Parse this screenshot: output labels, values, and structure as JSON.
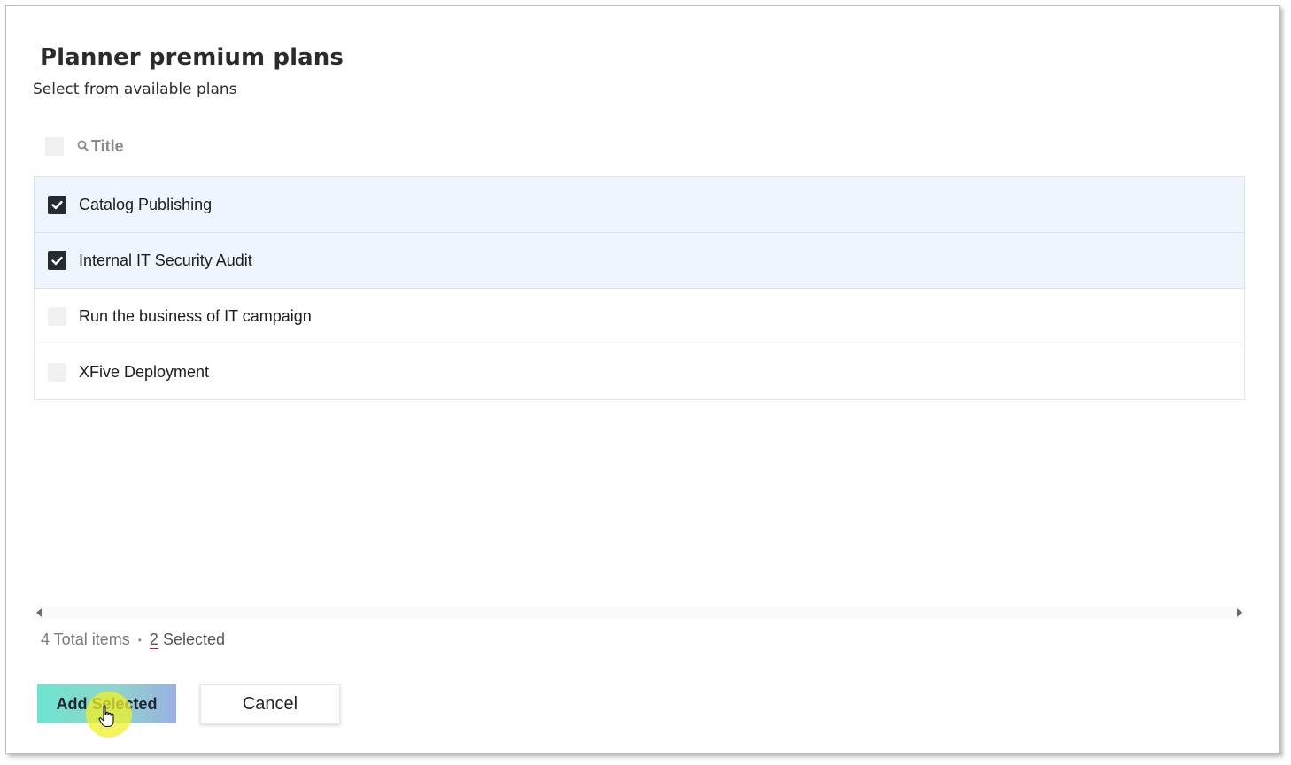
{
  "dialog": {
    "title": "Planner premium plans",
    "subtitle": "Select from available plans"
  },
  "table": {
    "header_label": "Title",
    "rows": [
      {
        "label": "Catalog Publishing",
        "checked": true
      },
      {
        "label": "Internal IT Security Audit",
        "checked": true
      },
      {
        "label": "Run the business of IT campaign",
        "checked": false
      },
      {
        "label": "XFive Deployment",
        "checked": false
      }
    ]
  },
  "status": {
    "total": "4 Total items",
    "separator": "•",
    "selected_count": "2",
    "selected_label": "Selected"
  },
  "buttons": {
    "add_selected": "Add Selected",
    "cancel": "Cancel"
  },
  "colors": {
    "checked_box": "#252a33",
    "selected_row": "#eef5fc",
    "primary_gradient_start": "#6ee3cf",
    "primary_gradient_end": "#9ab0e3"
  },
  "icons": {
    "search": "search-icon",
    "check": "check-icon",
    "cursor": "hand-pointer-icon"
  }
}
